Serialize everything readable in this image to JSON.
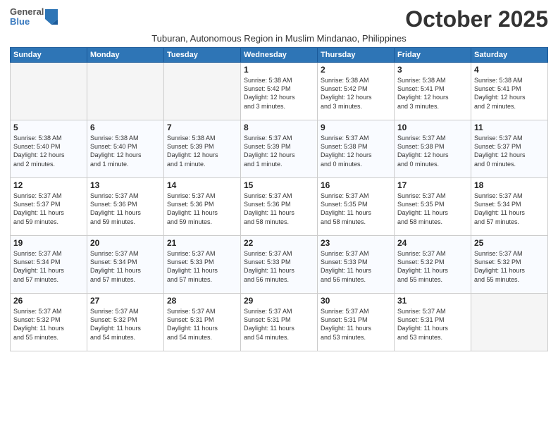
{
  "header": {
    "logo_general": "General",
    "logo_blue": "Blue",
    "month_title": "October 2025",
    "subtitle": "Tuburan, Autonomous Region in Muslim Mindanao, Philippines"
  },
  "weekdays": [
    "Sunday",
    "Monday",
    "Tuesday",
    "Wednesday",
    "Thursday",
    "Friday",
    "Saturday"
  ],
  "weeks": [
    [
      {
        "day": "",
        "info": ""
      },
      {
        "day": "",
        "info": ""
      },
      {
        "day": "",
        "info": ""
      },
      {
        "day": "1",
        "info": "Sunrise: 5:38 AM\nSunset: 5:42 PM\nDaylight: 12 hours\nand 3 minutes."
      },
      {
        "day": "2",
        "info": "Sunrise: 5:38 AM\nSunset: 5:42 PM\nDaylight: 12 hours\nand 3 minutes."
      },
      {
        "day": "3",
        "info": "Sunrise: 5:38 AM\nSunset: 5:41 PM\nDaylight: 12 hours\nand 3 minutes."
      },
      {
        "day": "4",
        "info": "Sunrise: 5:38 AM\nSunset: 5:41 PM\nDaylight: 12 hours\nand 2 minutes."
      }
    ],
    [
      {
        "day": "5",
        "info": "Sunrise: 5:38 AM\nSunset: 5:40 PM\nDaylight: 12 hours\nand 2 minutes."
      },
      {
        "day": "6",
        "info": "Sunrise: 5:38 AM\nSunset: 5:40 PM\nDaylight: 12 hours\nand 1 minute."
      },
      {
        "day": "7",
        "info": "Sunrise: 5:38 AM\nSunset: 5:39 PM\nDaylight: 12 hours\nand 1 minute."
      },
      {
        "day": "8",
        "info": "Sunrise: 5:37 AM\nSunset: 5:39 PM\nDaylight: 12 hours\nand 1 minute."
      },
      {
        "day": "9",
        "info": "Sunrise: 5:37 AM\nSunset: 5:38 PM\nDaylight: 12 hours\nand 0 minutes."
      },
      {
        "day": "10",
        "info": "Sunrise: 5:37 AM\nSunset: 5:38 PM\nDaylight: 12 hours\nand 0 minutes."
      },
      {
        "day": "11",
        "info": "Sunrise: 5:37 AM\nSunset: 5:37 PM\nDaylight: 12 hours\nand 0 minutes."
      }
    ],
    [
      {
        "day": "12",
        "info": "Sunrise: 5:37 AM\nSunset: 5:37 PM\nDaylight: 11 hours\nand 59 minutes."
      },
      {
        "day": "13",
        "info": "Sunrise: 5:37 AM\nSunset: 5:36 PM\nDaylight: 11 hours\nand 59 minutes."
      },
      {
        "day": "14",
        "info": "Sunrise: 5:37 AM\nSunset: 5:36 PM\nDaylight: 11 hours\nand 59 minutes."
      },
      {
        "day": "15",
        "info": "Sunrise: 5:37 AM\nSunset: 5:36 PM\nDaylight: 11 hours\nand 58 minutes."
      },
      {
        "day": "16",
        "info": "Sunrise: 5:37 AM\nSunset: 5:35 PM\nDaylight: 11 hours\nand 58 minutes."
      },
      {
        "day": "17",
        "info": "Sunrise: 5:37 AM\nSunset: 5:35 PM\nDaylight: 11 hours\nand 58 minutes."
      },
      {
        "day": "18",
        "info": "Sunrise: 5:37 AM\nSunset: 5:34 PM\nDaylight: 11 hours\nand 57 minutes."
      }
    ],
    [
      {
        "day": "19",
        "info": "Sunrise: 5:37 AM\nSunset: 5:34 PM\nDaylight: 11 hours\nand 57 minutes."
      },
      {
        "day": "20",
        "info": "Sunrise: 5:37 AM\nSunset: 5:34 PM\nDaylight: 11 hours\nand 57 minutes."
      },
      {
        "day": "21",
        "info": "Sunrise: 5:37 AM\nSunset: 5:33 PM\nDaylight: 11 hours\nand 57 minutes."
      },
      {
        "day": "22",
        "info": "Sunrise: 5:37 AM\nSunset: 5:33 PM\nDaylight: 11 hours\nand 56 minutes."
      },
      {
        "day": "23",
        "info": "Sunrise: 5:37 AM\nSunset: 5:33 PM\nDaylight: 11 hours\nand 56 minutes."
      },
      {
        "day": "24",
        "info": "Sunrise: 5:37 AM\nSunset: 5:32 PM\nDaylight: 11 hours\nand 55 minutes."
      },
      {
        "day": "25",
        "info": "Sunrise: 5:37 AM\nSunset: 5:32 PM\nDaylight: 11 hours\nand 55 minutes."
      }
    ],
    [
      {
        "day": "26",
        "info": "Sunrise: 5:37 AM\nSunset: 5:32 PM\nDaylight: 11 hours\nand 55 minutes."
      },
      {
        "day": "27",
        "info": "Sunrise: 5:37 AM\nSunset: 5:32 PM\nDaylight: 11 hours\nand 54 minutes."
      },
      {
        "day": "28",
        "info": "Sunrise: 5:37 AM\nSunset: 5:31 PM\nDaylight: 11 hours\nand 54 minutes."
      },
      {
        "day": "29",
        "info": "Sunrise: 5:37 AM\nSunset: 5:31 PM\nDaylight: 11 hours\nand 54 minutes."
      },
      {
        "day": "30",
        "info": "Sunrise: 5:37 AM\nSunset: 5:31 PM\nDaylight: 11 hours\nand 53 minutes."
      },
      {
        "day": "31",
        "info": "Sunrise: 5:37 AM\nSunset: 5:31 PM\nDaylight: 11 hours\nand 53 minutes."
      },
      {
        "day": "",
        "info": ""
      }
    ]
  ]
}
